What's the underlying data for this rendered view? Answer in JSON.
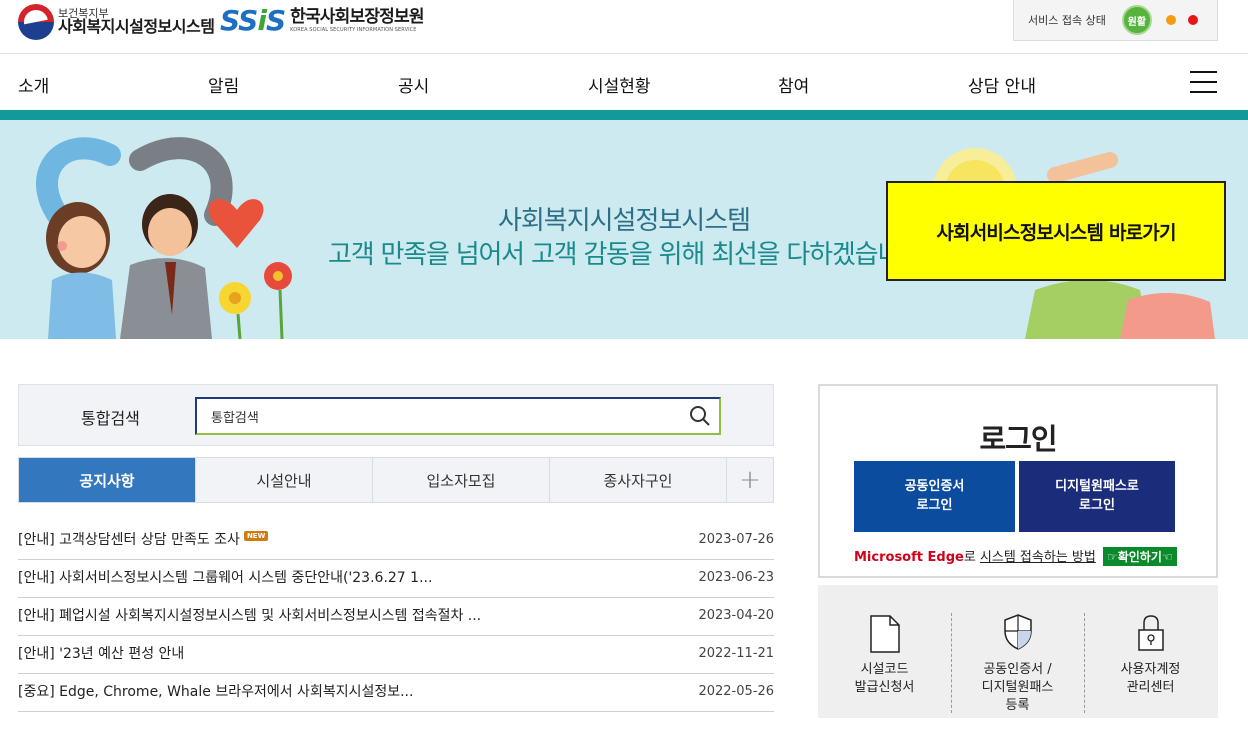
{
  "header": {
    "mohw_small": "보건복지부",
    "mohw_big": "사회복지시설정보시스템",
    "ssis_mark_left": "SS",
    "ssis_mark_i": "i",
    "ssis_mark_right": "S",
    "ssis_name": "한국사회보장정보원",
    "ssis_eng": "KOREA SOCIAL SECURITY INFORMATION SERVICE",
    "status_label": "서비스 접속 상태",
    "status_value": "원활"
  },
  "nav": {
    "items": [
      "소개",
      "알림",
      "공시",
      "시설현황",
      "참여",
      "상담 안내"
    ]
  },
  "banner": {
    "title": "사회복지시설정보시스템",
    "subtitle": "고객 만족을 넘어서 고객 감동을 위해 최선을 다하겠습니다",
    "shortcut_label": "사회서비스정보시스템 바로가기"
  },
  "search": {
    "label": "통합검색",
    "value": "통합검색"
  },
  "tabs": {
    "items": [
      "공지사항",
      "시설안내",
      "입소자모집",
      "종사자구인"
    ],
    "more": "+"
  },
  "notices": [
    {
      "title": "[안내] 고객상담센터 상담 만족도 조사",
      "date": "2023-07-26",
      "badge": "NEW"
    },
    {
      "title": "[안내] 사회서비스정보시스템 그룹웨어 시스템 중단안내('23.6.27 1...",
      "date": "2023-06-23"
    },
    {
      "title": "[안내] 폐업시설 사회복지시설정보시스템 및 사회서비스정보시스템 접속절차 ...",
      "date": "2023-04-20"
    },
    {
      "title": "[안내] '23년 예산 편성 안내",
      "date": "2022-11-21"
    },
    {
      "title": "[중요] Edge, Chrome, Whale 브라우저에서 사회복지시설정보...",
      "date": "2022-05-26"
    }
  ],
  "login": {
    "title": "로그인",
    "cert_line1": "공동인증서",
    "cert_line2": "로그인",
    "digital_line1": "디지털원패스로",
    "digital_line2": "로그인",
    "edge_brand": "Microsoft Edge",
    "edge_mid": "로 ",
    "edge_link": "시스템 접속하는 방법",
    "confirm": "☞확인하기☜"
  },
  "quick": [
    {
      "icon": "document-icon",
      "line1": "시설코드",
      "line2": "발급신청서",
      "line3": ""
    },
    {
      "icon": "shield-icon",
      "line1": "공동인증서 /",
      "line2": "디지털원패스",
      "line3": "등록"
    },
    {
      "icon": "lock-icon",
      "line1": "사용자계정",
      "line2": "관리센터",
      "line3": ""
    }
  ],
  "colors": {
    "teal": "#12999a",
    "active_tab": "#3377bf",
    "cert_btn": "#0b4c9e",
    "digital_btn": "#1b2d7a",
    "shortcut": "#ffff00"
  }
}
